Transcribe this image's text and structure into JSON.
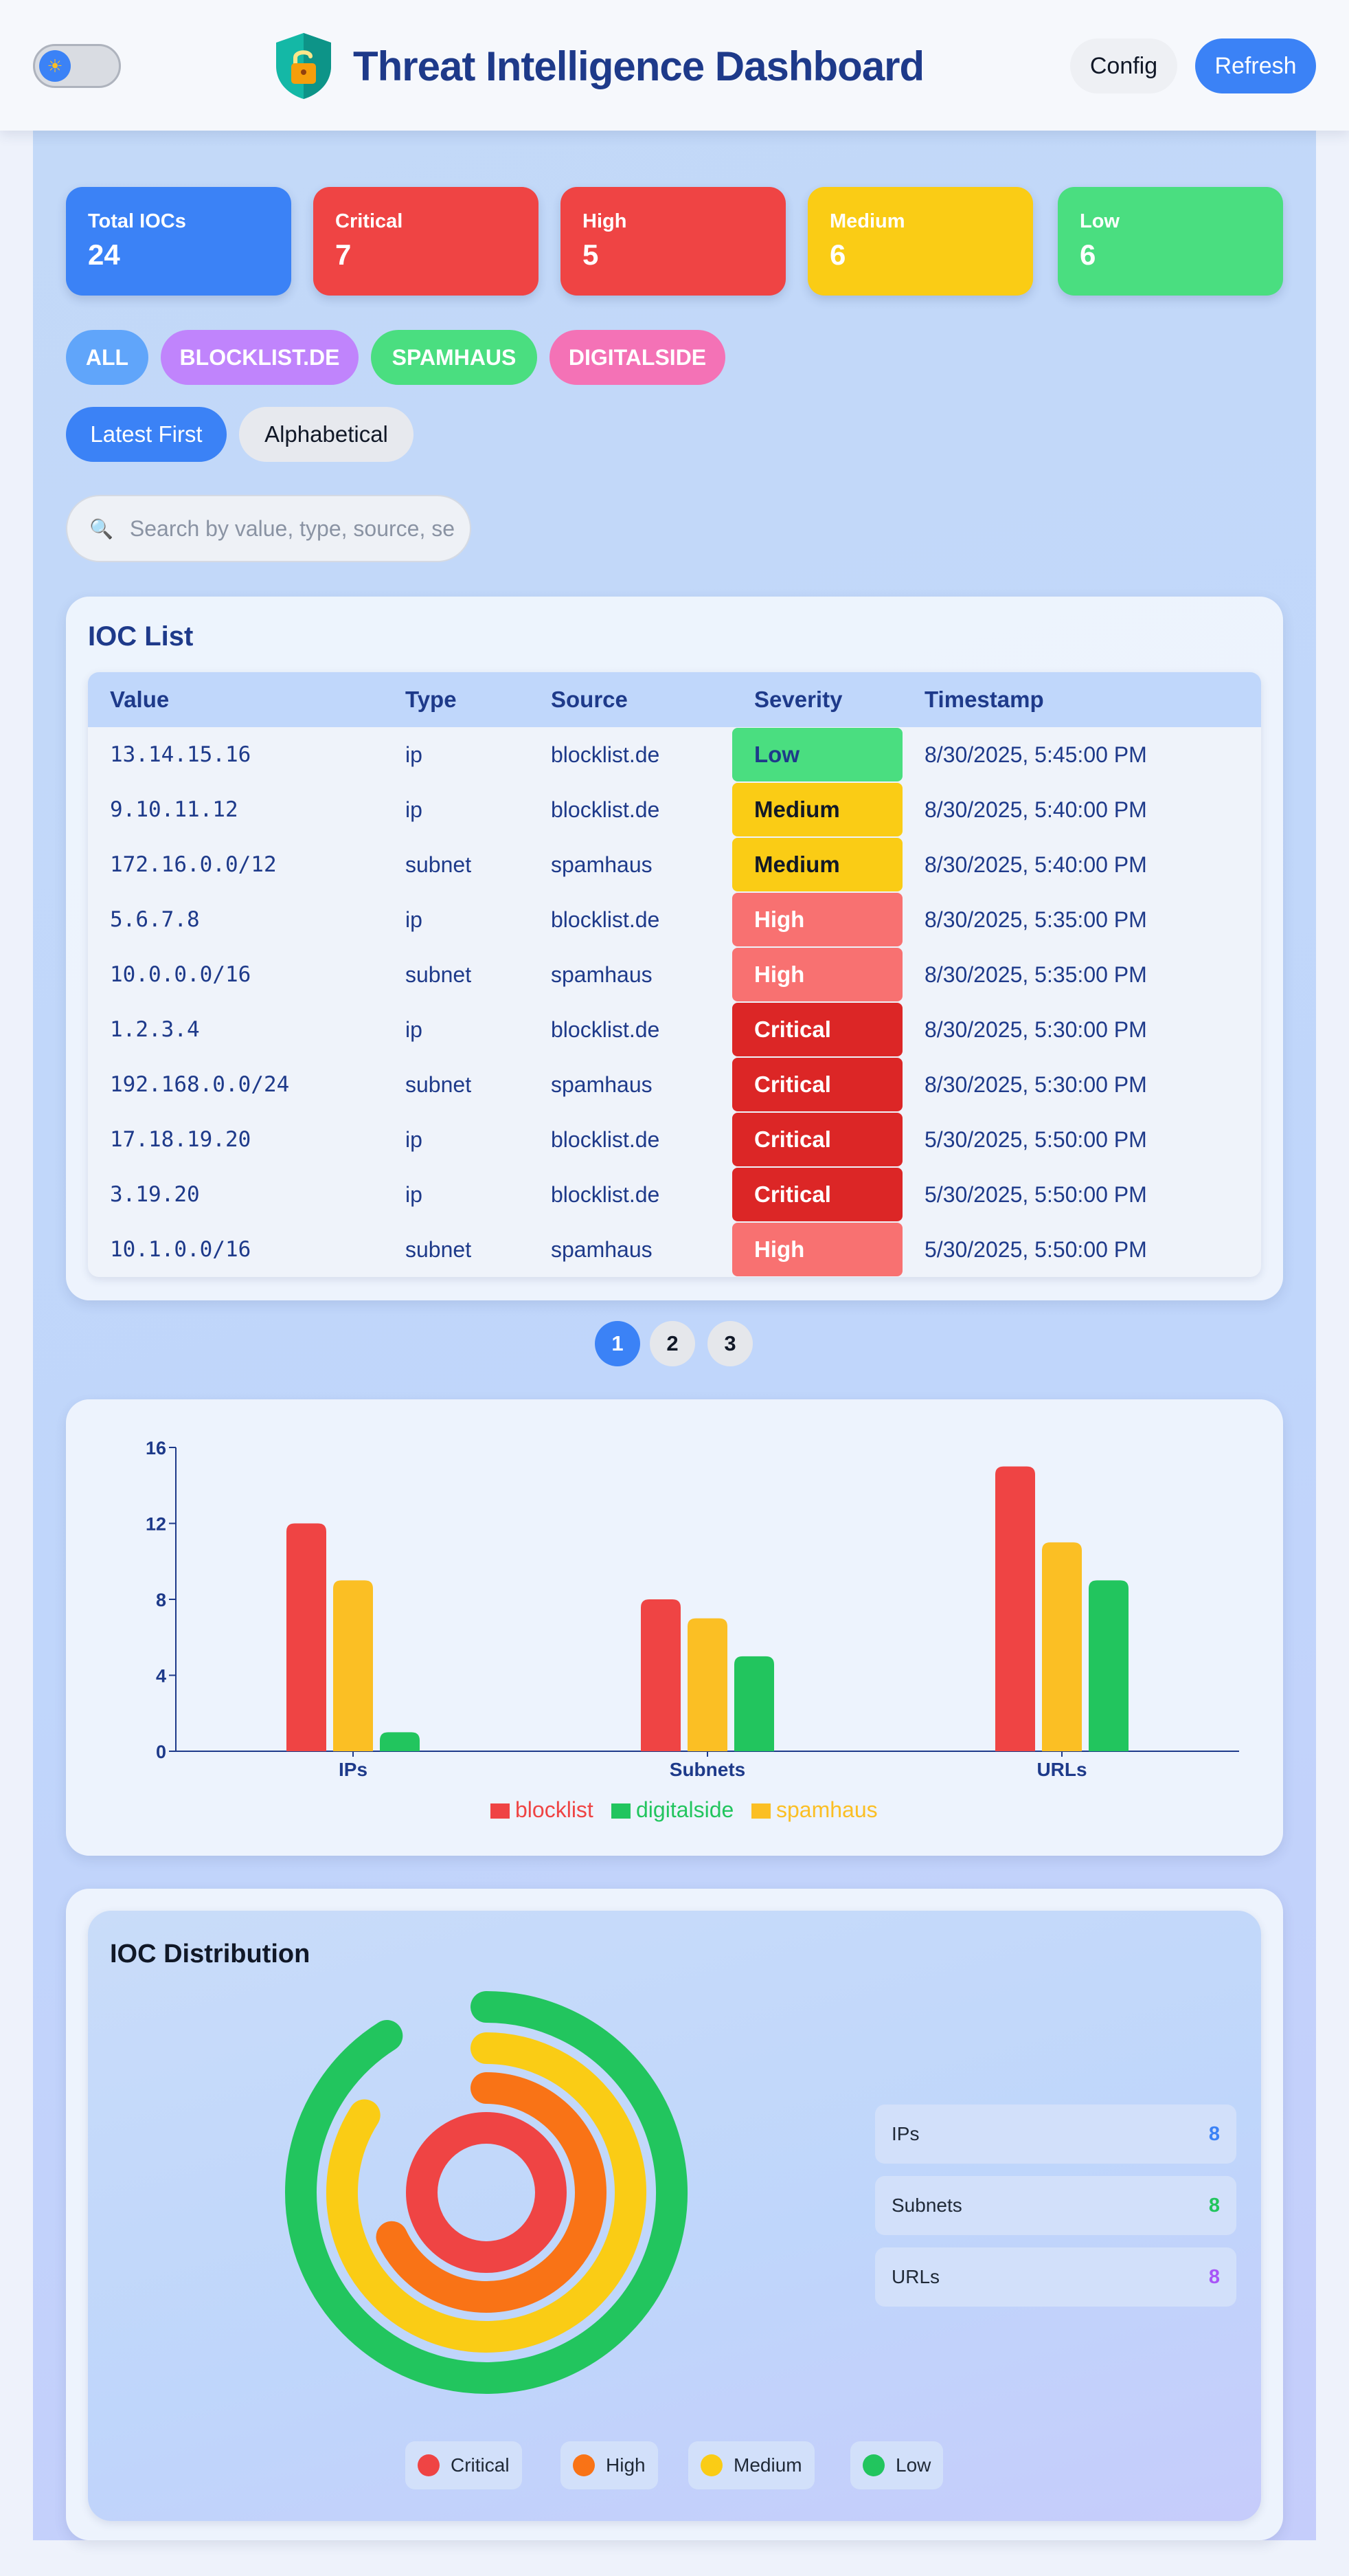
{
  "header": {
    "title": "Threat Intelligence Dashboard",
    "config_label": "Config",
    "refresh_label": "Refresh",
    "theme_icon": "sun-icon",
    "logo_icon": "shield-lock-icon"
  },
  "stats": [
    {
      "label": "Total IOCs",
      "value": "24",
      "color": "#3b82f6"
    },
    {
      "label": "Critical",
      "value": "7",
      "color": "#ef4444"
    },
    {
      "label": "High",
      "value": "5",
      "color": "#ef4444"
    },
    {
      "label": "Medium",
      "value": "6",
      "color": "#facc15"
    },
    {
      "label": "Low",
      "value": "6",
      "color": "#4ade80"
    }
  ],
  "source_filters": [
    {
      "label": "ALL",
      "color": "#60a5fa"
    },
    {
      "label": "BLOCKLIST.DE",
      "color": "#c084fc"
    },
    {
      "label": "SPAMHAUS",
      "color": "#4ade80"
    },
    {
      "label": "DIGITALSIDE",
      "color": "#f472b6"
    }
  ],
  "sort": {
    "latest_label": "Latest First",
    "alpha_label": "Alphabetical"
  },
  "search": {
    "placeholder": "Search by value, type, source, se"
  },
  "ioc_list": {
    "title": "IOC List",
    "columns": [
      "Value",
      "Type",
      "Source",
      "Severity",
      "Timestamp"
    ],
    "rows": [
      {
        "value": "13.14.15.16",
        "type": "ip",
        "source": "blocklist.de",
        "severity": "Low",
        "timestamp": "8/30/2025, 5:45:00 PM"
      },
      {
        "value": "9.10.11.12",
        "type": "ip",
        "source": "blocklist.de",
        "severity": "Medium",
        "timestamp": "8/30/2025, 5:40:00 PM"
      },
      {
        "value": "172.16.0.0/12",
        "type": "subnet",
        "source": "spamhaus",
        "severity": "Medium",
        "timestamp": "8/30/2025, 5:40:00 PM"
      },
      {
        "value": "5.6.7.8",
        "type": "ip",
        "source": "blocklist.de",
        "severity": "High",
        "timestamp": "8/30/2025, 5:35:00 PM"
      },
      {
        "value": "10.0.0.0/16",
        "type": "subnet",
        "source": "spamhaus",
        "severity": "High",
        "timestamp": "8/30/2025, 5:35:00 PM"
      },
      {
        "value": "1.2.3.4",
        "type": "ip",
        "source": "blocklist.de",
        "severity": "Critical",
        "timestamp": "8/30/2025, 5:30:00 PM"
      },
      {
        "value": "192.168.0.0/24",
        "type": "subnet",
        "source": "spamhaus",
        "severity": "Critical",
        "timestamp": "8/30/2025, 5:30:00 PM"
      },
      {
        "value": "17.18.19.20",
        "type": "ip",
        "source": "blocklist.de",
        "severity": "Critical",
        "timestamp": "5/30/2025, 5:50:00 PM"
      },
      {
        "value": "3.19.20",
        "type": "ip",
        "source": "blocklist.de",
        "severity": "Critical",
        "timestamp": "5/30/2025, 5:50:00 PM"
      },
      {
        "value": "10.1.0.0/16",
        "type": "subnet",
        "source": "spamhaus",
        "severity": "High",
        "timestamp": "5/30/2025, 5:50:00 PM"
      }
    ]
  },
  "severity_colors": {
    "Low": {
      "bg": "#4ade80",
      "fg": "#1e3a8a"
    },
    "Medium": {
      "bg": "#facc15",
      "fg": "#111827"
    },
    "High": {
      "bg": "#f87171",
      "fg": "#ffffff"
    },
    "Critical": {
      "bg": "#dc2626",
      "fg": "#ffffff"
    }
  },
  "pagination": {
    "pages": [
      "1",
      "2",
      "3"
    ],
    "active": "1"
  },
  "chart_data": [
    {
      "type": "bar",
      "categories": [
        "IPs",
        "Subnets",
        "URLs"
      ],
      "series": [
        {
          "name": "blocklist",
          "color": "#ef4444",
          "values": [
            12,
            8,
            15
          ]
        },
        {
          "name": "spamhaus",
          "color": "#fbbf24",
          "values": [
            9,
            7,
            11
          ]
        },
        {
          "name": "digitalside",
          "color": "#22c55e",
          "values": [
            1,
            5,
            9
          ]
        }
      ],
      "legend_order": [
        "blocklist",
        "digitalside",
        "spamhaus"
      ],
      "ylim": [
        0,
        16
      ],
      "yticks": [
        0,
        4,
        8,
        12,
        16
      ],
      "grid": false,
      "legend_position": "bottom"
    },
    {
      "type": "pie",
      "subtype": "radial-bar",
      "title": "IOC Distribution",
      "categories": [
        "Critical",
        "High",
        "Medium",
        "Low"
      ],
      "colors": [
        "#ef4444",
        "#f97316",
        "#facc15",
        "#22c55e"
      ],
      "arc_fractions": [
        1.0,
        0.68,
        0.84,
        0.91
      ],
      "legend_position": "bottom"
    }
  ],
  "distribution": {
    "title": "IOC Distribution",
    "counts": [
      {
        "label": "IPs",
        "value": "8",
        "color": "#3b82f6"
      },
      {
        "label": "Subnets",
        "value": "8",
        "color": "#22c55e"
      },
      {
        "label": "URLs",
        "value": "8",
        "color": "#a855f7"
      }
    ],
    "legend": [
      {
        "label": "Critical",
        "color": "#ef4444"
      },
      {
        "label": "High",
        "color": "#f97316"
      },
      {
        "label": "Medium",
        "color": "#facc15"
      },
      {
        "label": "Low",
        "color": "#22c55e"
      }
    ]
  }
}
